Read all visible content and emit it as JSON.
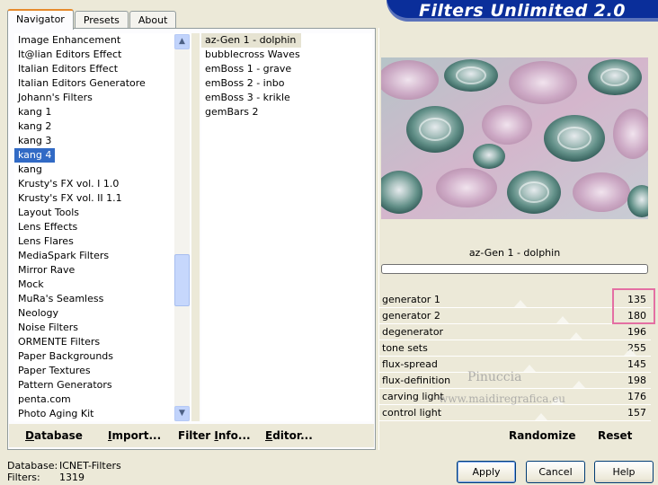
{
  "tabs": [
    "Navigator",
    "Presets",
    "About"
  ],
  "banner": "Filters Unlimited 2.0",
  "categories": [
    "Image Enhancement",
    "It@lian Editors Effect",
    "Italian Editors Effect",
    "Italian Editors Generatore",
    "Johann's Filters",
    "kang 1",
    "kang 2",
    "kang 3",
    "kang 4",
    "kang",
    "Krusty's FX vol. I 1.0",
    "Krusty's FX vol. II 1.1",
    "Layout Tools",
    "Lens Effects",
    "Lens Flares",
    "MediaSpark Filters",
    "Mirror Rave",
    "Mock",
    "MuRa's Seamless",
    "Neology",
    "Noise Filters",
    "ORMENTE Filters",
    "Paper Backgrounds",
    "Paper Textures",
    "Pattern Generators",
    "penta.com",
    "Photo Aging Kit"
  ],
  "selected_category": "kang 4",
  "filters": [
    "az-Gen 1  -  dolphin",
    "bubblecross Waves",
    "emBoss 1  -  grave",
    "emBoss 2  -  inbo",
    "emBoss 3  -  krikle",
    "gemBars 2"
  ],
  "selected_filter": "az-Gen 1  -  dolphin",
  "buttons_left": {
    "database": "Database",
    "import": "Import...",
    "filter_info": "Filter Info...",
    "editor": "Editor..."
  },
  "current_filter_label": "az-Gen 1  -  dolphin",
  "sliders": [
    {
      "label": "generator 1",
      "value": "135",
      "level": 0.53
    },
    {
      "label": "generator 2",
      "value": "180",
      "level": 0.71
    },
    {
      "label": "degenerator",
      "value": "196",
      "level": 0.77
    },
    {
      "label": "tone sets",
      "value": "255",
      "level": 1.0
    },
    {
      "label": "flux-spread",
      "value": "145",
      "level": 0.57
    },
    {
      "label": "flux-definition",
      "value": "198",
      "level": 0.78
    },
    {
      "label": "carving light",
      "value": "176",
      "level": 0.69
    },
    {
      "label": "control light",
      "value": "157",
      "level": 0.62
    }
  ],
  "randomize": "Randomize",
  "reset": "Reset",
  "watermark": {
    "line1": "Pinuccia",
    "line2": "www.maidiregrafica.eu"
  },
  "status": {
    "database_label": "Database:",
    "database_value": "ICNET-Filters",
    "filters_label": "Filters:",
    "filters_value": "1319"
  },
  "dialog_buttons": {
    "apply": "Apply",
    "cancel": "Cancel",
    "help": "Help"
  },
  "colors": {
    "banner": "#0a2e9a",
    "selection": "#316ac5",
    "highlight": "#e46fa3"
  }
}
